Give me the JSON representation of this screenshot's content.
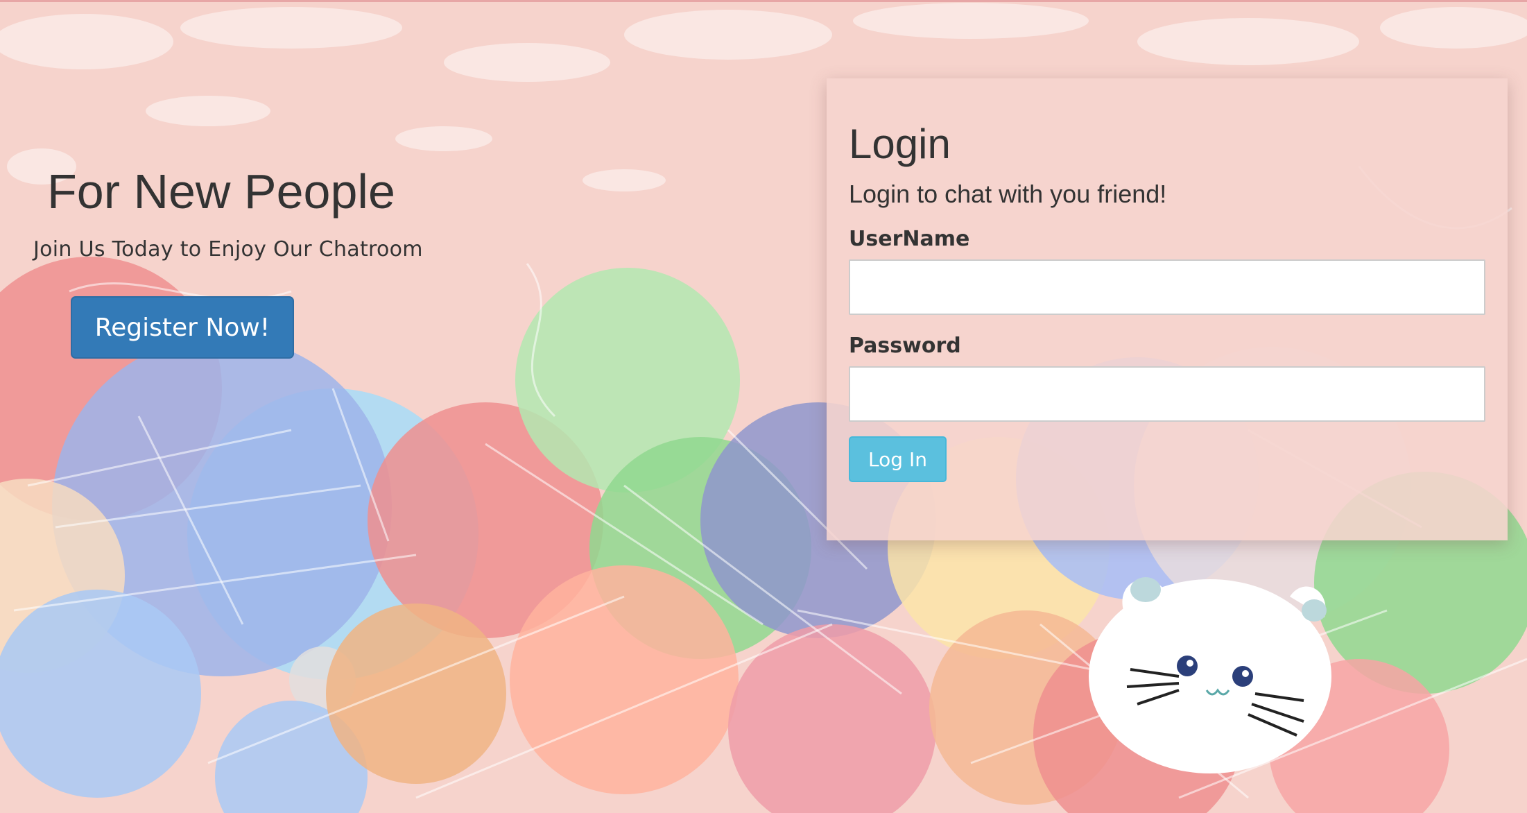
{
  "hero": {
    "title": "For New People",
    "subtitle": "Join Us Today to Enjoy Our Chatroom",
    "register_label": "Register Now!"
  },
  "login": {
    "title": "Login",
    "subtitle": "Login to chat with you friend!",
    "username_label": "UserName",
    "username_value": "",
    "password_label": "Password",
    "password_value": "",
    "submit_label": "Log In"
  },
  "colors": {
    "background": "#f6d3cc",
    "register_button": "#337ab7",
    "login_button": "#5bc0de",
    "text": "#333333"
  }
}
